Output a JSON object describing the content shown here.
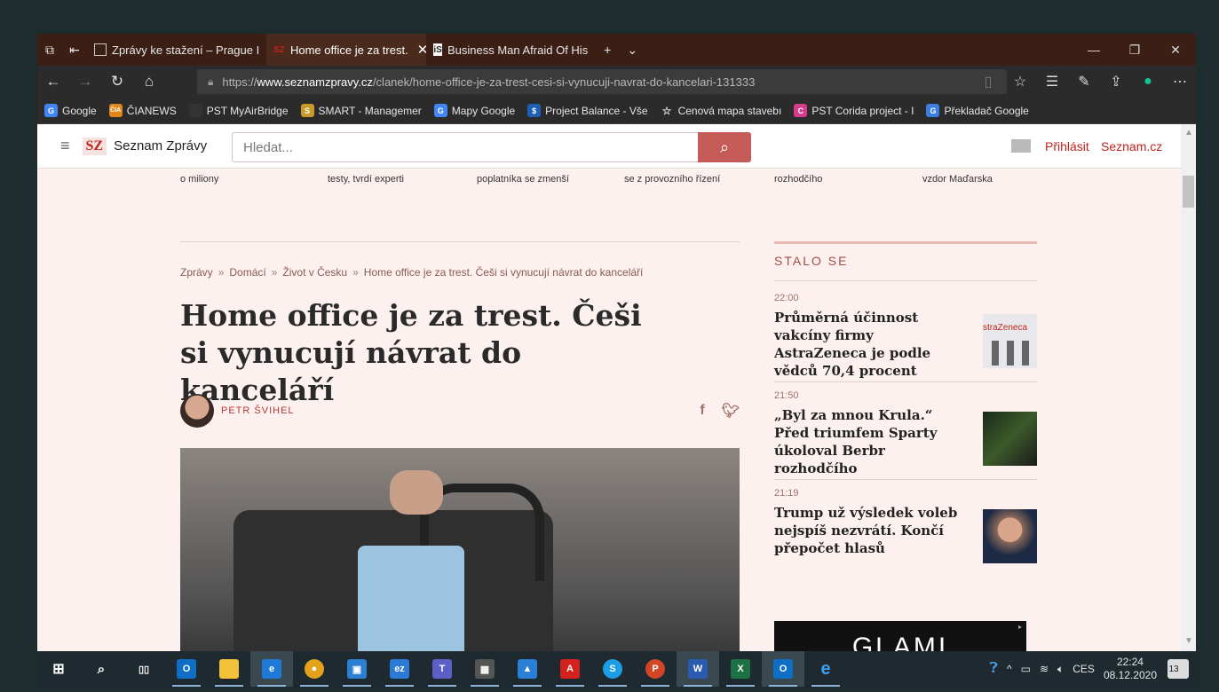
{
  "tabs": [
    {
      "label": "Zprávy ke stažení – Prague I",
      "active": false
    },
    {
      "label": "Home office je za trest.",
      "active": true
    },
    {
      "label": "Business Man Afraid Of His",
      "active": false
    }
  ],
  "address": {
    "prefix": "https://",
    "domain": "www.seznamzpravy.cz",
    "path": "/clanek/home-office-je-za-trest-cesi-si-vynucuji-navrat-do-kancelari-131333"
  },
  "bookmarks": [
    {
      "label": "Google",
      "icon": "G",
      "color": "#4285f4"
    },
    {
      "label": "ČIANEWS",
      "icon": "ČIA",
      "color": "#e2861c"
    },
    {
      "label": "PST MyAirBridge",
      "icon": "",
      "color": "#2b2b2b"
    },
    {
      "label": "SMART - Managemer",
      "icon": "S",
      "color": "#c79a2a"
    },
    {
      "label": "Mapy Google",
      "icon": "G",
      "color": "#4285f4"
    },
    {
      "label": "Project Balance - Vše",
      "icon": "$",
      "color": "#1d5fb3"
    },
    {
      "label": "Cenová mapa stavebı",
      "icon": "☆",
      "color": "#2b2b2b"
    },
    {
      "label": "PST Corida project - I",
      "icon": "C",
      "color": "#d63a8a"
    },
    {
      "label": "Překladač Google",
      "icon": "G",
      "color": "#3b7de0"
    }
  ],
  "site": {
    "logo": "SZ",
    "name": "Seznam Zprávy",
    "search_placeholder": "Hledat...",
    "login": "Přihlásit",
    "seznam": "Seznam.cz"
  },
  "strip_left": [
    "o miliony",
    "testy, tvrdí experti",
    "poplatníka se zmenší",
    "se z provozního řízení"
  ],
  "strip_right": [
    "rozhodčího",
    "vzdor Maďarska"
  ],
  "breadcrumb": [
    "Zprávy",
    "Domácí",
    "Život v Česku",
    "Home office je za trest. Češi si vynucují návrat do kanceláří"
  ],
  "breadcrumb_sep": "»",
  "article": {
    "title": "Home office je za trest. Češi si vynucují návrat do kanceláří",
    "author": "PETR ŠVIHEL"
  },
  "sidebar": {
    "heading": "STALO SE",
    "items": [
      {
        "time": "22:00",
        "headline": "Průměrná účinnost vakcíny firmy AstraZeneca je podle vědců 70,4 procent",
        "thumb_text": "straZeneca"
      },
      {
        "time": "21:50",
        "headline": "„Byl za mnou Krula.“ Před triumfem Sparty úkoloval Berbr rozhodčího",
        "thumb_text": ""
      },
      {
        "time": "21:19",
        "headline": "Trump už výsledek voleb nejspíš nezvrátí. Končí přepočet hlasů",
        "thumb_text": ""
      }
    ],
    "ad": "GLAMI"
  },
  "taskbar": {
    "lang": "CES",
    "time": "22:24",
    "date": "08.12.2020",
    "notifications": "13"
  }
}
